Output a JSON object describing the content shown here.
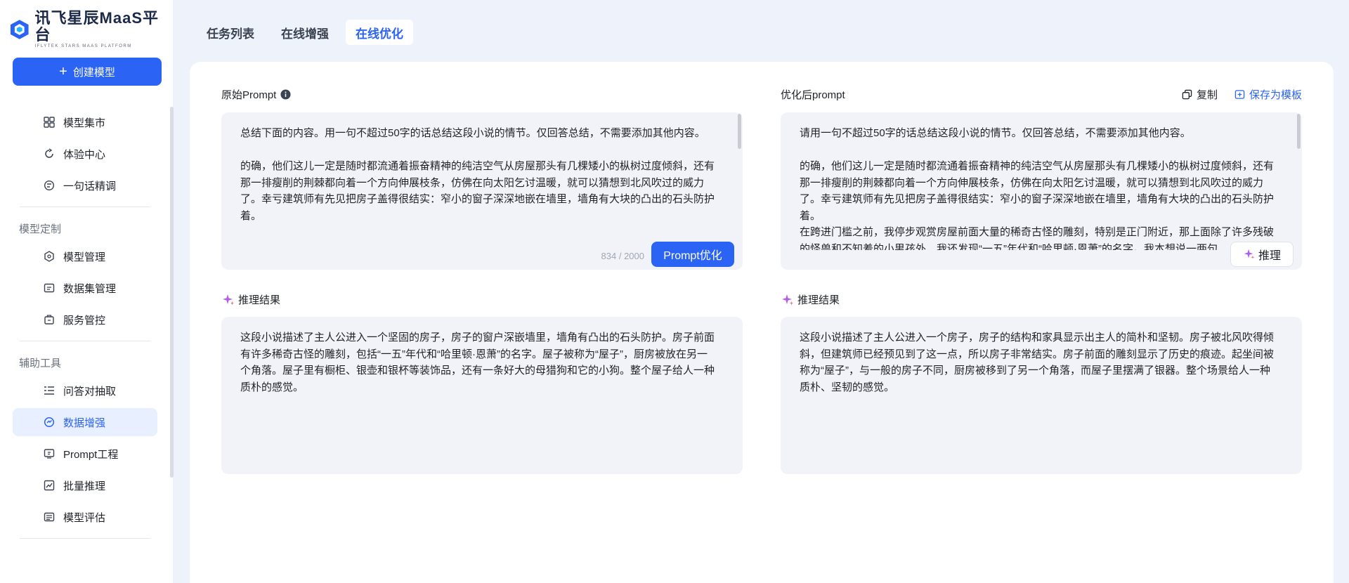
{
  "sidebar": {
    "logo_title": "讯飞星辰MaaS平台",
    "logo_subtitle": "IFLYTEK STARS MAAS PLATFORM",
    "create_label": "创建模型",
    "items_top": [
      {
        "label": "模型集市",
        "icon": "grid-icon"
      },
      {
        "label": "体验中心",
        "icon": "refresh-icon"
      },
      {
        "label": "一句话精调",
        "icon": "tune-icon"
      }
    ],
    "group_custom": "模型定制",
    "items_custom": [
      {
        "label": "模型管理",
        "icon": "model-icon"
      },
      {
        "label": "数据集管理",
        "icon": "dataset-icon"
      },
      {
        "label": "服务管控",
        "icon": "service-icon"
      }
    ],
    "group_tools": "辅助工具",
    "items_tools": [
      {
        "label": "问答对抽取",
        "icon": "list-icon"
      },
      {
        "label": "数据增强",
        "icon": "enhance-icon",
        "active": true
      },
      {
        "label": "Prompt工程",
        "icon": "prompt-icon"
      },
      {
        "label": "批量推理",
        "icon": "chart-icon"
      },
      {
        "label": "模型评估",
        "icon": "eval-icon"
      }
    ]
  },
  "tabs": [
    "任务列表",
    "在线增强",
    "在线优化"
  ],
  "active_tab": "在线优化",
  "left": {
    "title": "原始Prompt",
    "prompt_text": "总结下面的内容。用一句不超过50字的话总结这段小说的情节。仅回答总结，不需要添加其他内容。\n\n的确，他们这儿一定是随时都流通着振奋精神的纯洁空气从房屋那头有几棵矮小的枞树过度倾斜，还有那一排瘦削的荆棘都向着一个方向伸展枝条，仿佛在向太阳乞讨温暖，就可以猜想到北风吹过的威力了。幸亏建筑师有先见把房子盖得很结实：窄小的窗子深深地嵌在墙里，墙角有大块的凸出的石头防护着。",
    "counter": "834 / 2000",
    "optimize_label": "Prompt优化",
    "result_title": "推理结果",
    "result_text": "这段小说描述了主人公进入一个坚固的房子，房子的窗户深嵌墙里，墙角有凸出的石头防护。房子前面有许多稀奇古怪的雕刻，包括“一五”年代和“哈里顿·恩萧”的名字。屋子被称为“屋子”，厨房被放在另一个角落。屋子里有橱柜、银壶和银杯等装饰品，还有一条好大的母猎狗和它的小狗。整个屋子给人一种质朴的感觉。"
  },
  "right": {
    "title": "优化后prompt",
    "copy_label": "复制",
    "save_label": "保存为模板",
    "prompt_text": "请用一句不超过50字的话总结这段小说的情节。仅回答总结，不需要添加其他内容。\n\n的确，他们这儿一定是随时都流通着振奋精神的纯洁空气从房屋那头有几棵矮小的枞树过度倾斜，还有那一排瘦削的荆棘都向着一个方向伸展枝条，仿佛在向太阳乞讨温暖，就可以猜想到北风吹过的威力了。幸亏建筑师有先见把房子盖得很结实：窄小的窗子深深地嵌在墙里，墙角有大块的凸出的石头防护着。\n在跨进门槛之前，我停步观赏房屋前面大量的稀奇古怪的雕刻，特别是正门附近，那上面除了许多残破的怪兽和不知羞的小男孩外，我还发现“一五”年代和“哈里顿·恩萧”的名字。我本想说一两句",
    "infer_label": "推理",
    "result_title": "推理结果",
    "result_text": "这段小说描述了主人公进入一个房子，房子的结构和家具显示出主人的简朴和坚韧。房子被北风吹得倾斜，但建筑师已经预见到了这一点，所以房子非常结实。房子前面的雕刻显示了历史的痕迹。起坐间被称为“屋子”，与一般的房子不同，厨房被移到了另一个角落，而屋子里摆满了银器。整个场景给人一种质朴、坚韧的感觉。"
  },
  "colors": {
    "accent": "#2b63f5",
    "background": "#eef2fb"
  }
}
